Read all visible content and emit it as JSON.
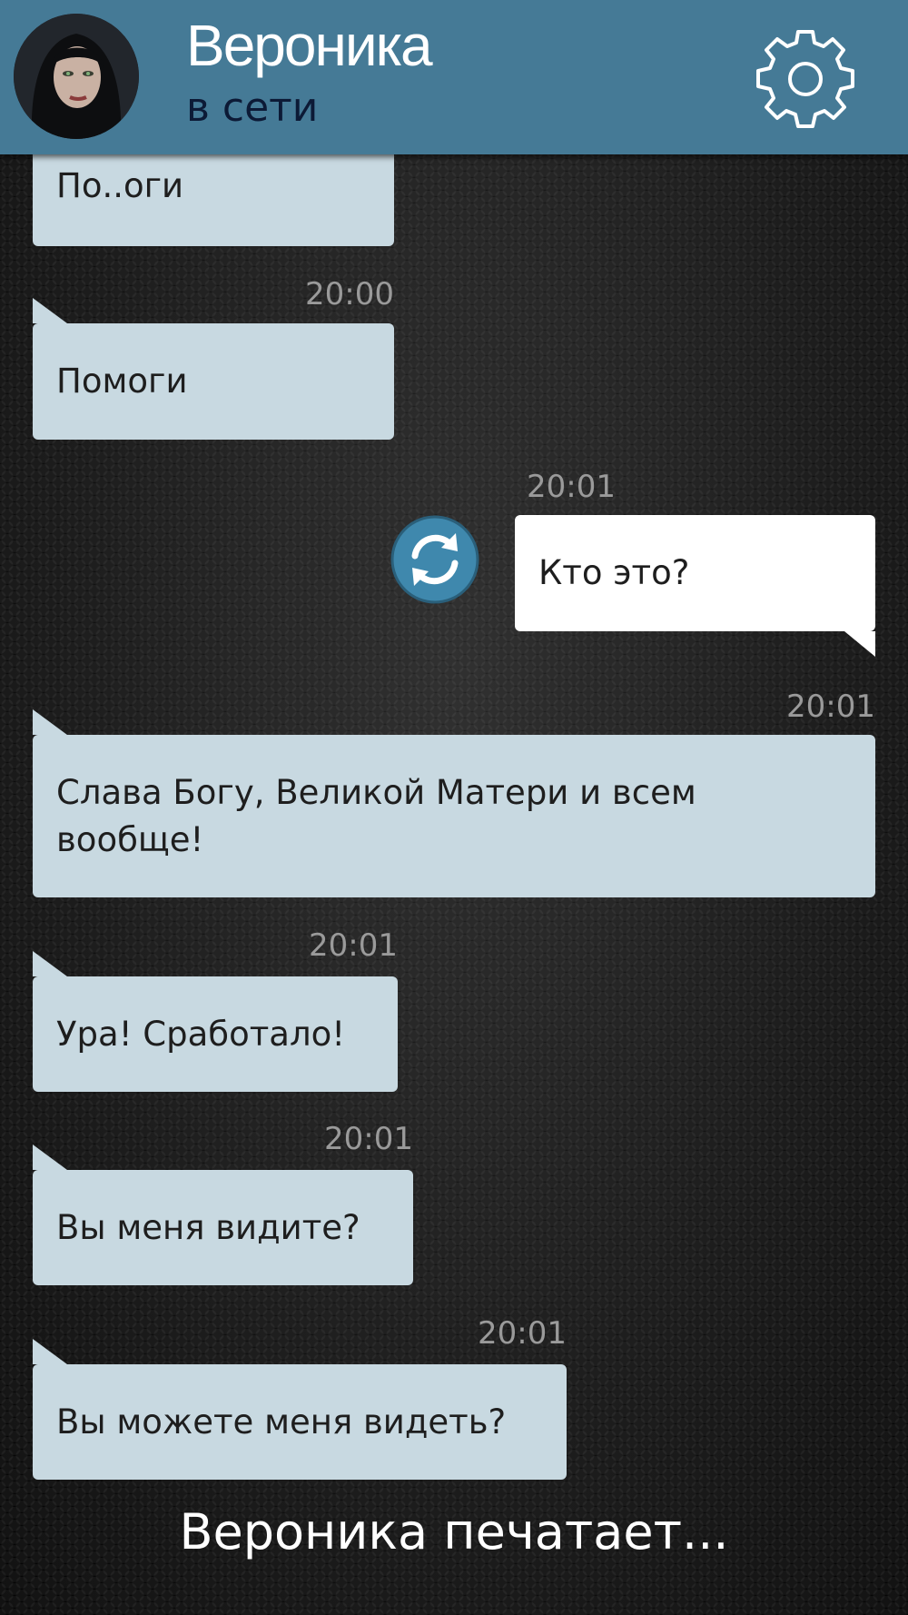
{
  "header": {
    "contact_name": "Вероника",
    "status": "в сети",
    "avatar_icon": "avatar",
    "settings_icon": "gear-icon",
    "background_color": "#457a96"
  },
  "messages": [
    {
      "direction": "incoming",
      "time": "",
      "text": "По..оги"
    },
    {
      "direction": "incoming",
      "time": "20:00",
      "text": "Помоги"
    },
    {
      "direction": "outgoing",
      "time": "20:01",
      "text": "Кто это?"
    },
    {
      "direction": "incoming",
      "time": "20:01",
      "text": "Слава Богу, Великой Матери и всем вообще!"
    },
    {
      "direction": "incoming",
      "time": "20:01",
      "text": "Ура! Сработало!"
    },
    {
      "direction": "incoming",
      "time": "20:01",
      "text": "Вы меня видите?"
    },
    {
      "direction": "incoming",
      "time": "20:01",
      "text": "Вы можете меня видеть?"
    }
  ],
  "refresh_icon": "refresh-icon",
  "typing_indicator": "Вероника печатает...",
  "colors": {
    "incoming_bubble": "#c8d9e1",
    "outgoing_bubble": "#ffffff",
    "timestamp": "#9a9a9a"
  }
}
